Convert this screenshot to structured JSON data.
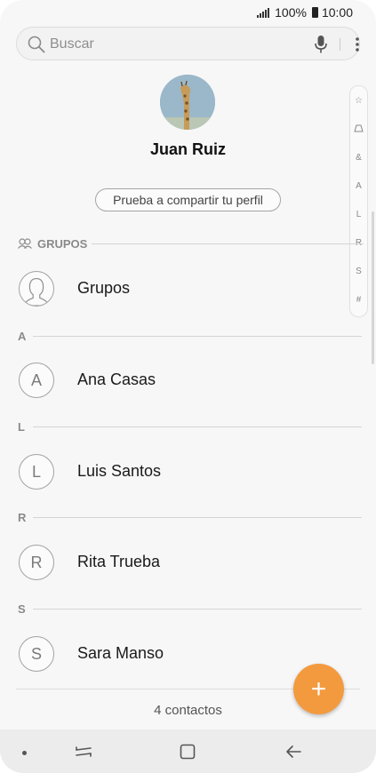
{
  "status_bar": {
    "battery": "100%",
    "time": "10:00"
  },
  "search": {
    "placeholder": "Buscar"
  },
  "profile": {
    "name": "Juan Ruiz",
    "share_label": "Prueba a compartir tu perfil"
  },
  "index_letters": [
    "☆",
    "ᴬ",
    "&",
    "A",
    "L",
    "R",
    "S",
    "#"
  ],
  "groups_section": {
    "header": "GRUPOS",
    "item": "Grupos"
  },
  "sections": [
    {
      "letter": "A",
      "contact": {
        "initial": "A",
        "name": "Ana Casas"
      }
    },
    {
      "letter": "L",
      "contact": {
        "initial": "L",
        "name": "Luis Santos"
      }
    },
    {
      "letter": "R",
      "contact": {
        "initial": "R",
        "name": "Rita Trueba"
      }
    },
    {
      "letter": "S",
      "contact": {
        "initial": "S",
        "name": "Sara Manso"
      }
    }
  ],
  "footer": {
    "count": "4 contactos"
  },
  "fab": {
    "label": "+",
    "color": "#f39a3f"
  },
  "icons": [
    "search-icon",
    "microphone-icon",
    "more-options-icon",
    "groups-icon",
    "add-icon",
    "recent-apps-icon",
    "home-icon",
    "back-icon"
  ]
}
